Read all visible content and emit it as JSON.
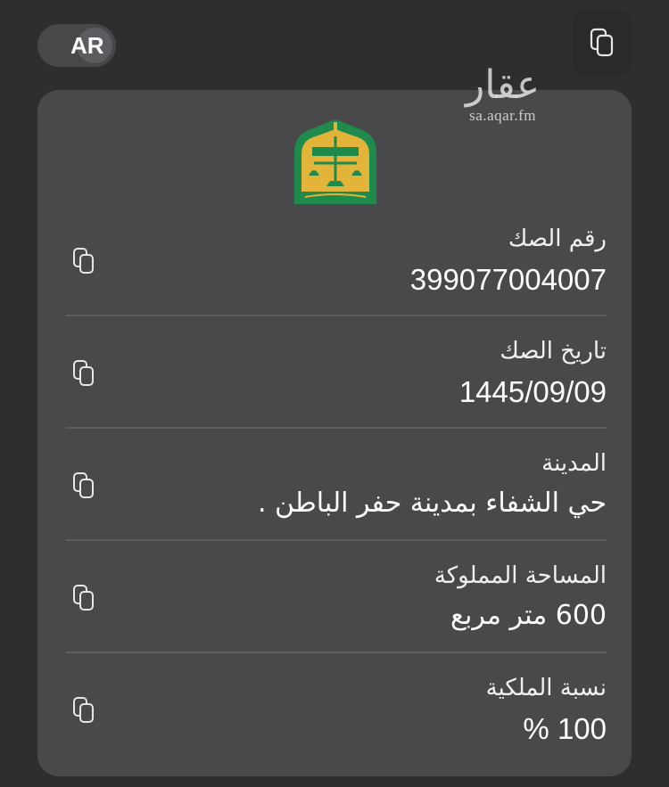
{
  "header": {
    "language_toggle_label": "AR"
  },
  "watermark": {
    "logo_text": "عقار",
    "url": "sa.aqar.fm"
  },
  "emblem": {
    "name": "وزارة العدل"
  },
  "deed": {
    "rows": [
      {
        "label": "رقم الصك",
        "value": "399077004007"
      },
      {
        "label": "تاريخ الصك",
        "value": "1445/09/09"
      },
      {
        "label": "المدينة",
        "value": "حي الشفاء  بمدينة حفر الباطن ."
      },
      {
        "label": "المساحة المملوكة",
        "value": "600 متر مربع"
      },
      {
        "label": "نسبة الملكية",
        "value": "100 %"
      }
    ]
  },
  "colors": {
    "background": "#2e2e30",
    "card": "#49494c",
    "emblem_green": "#1f8a4c",
    "emblem_gold": "#e3b43a"
  },
  "icons": {
    "copy": "copy-icon"
  }
}
